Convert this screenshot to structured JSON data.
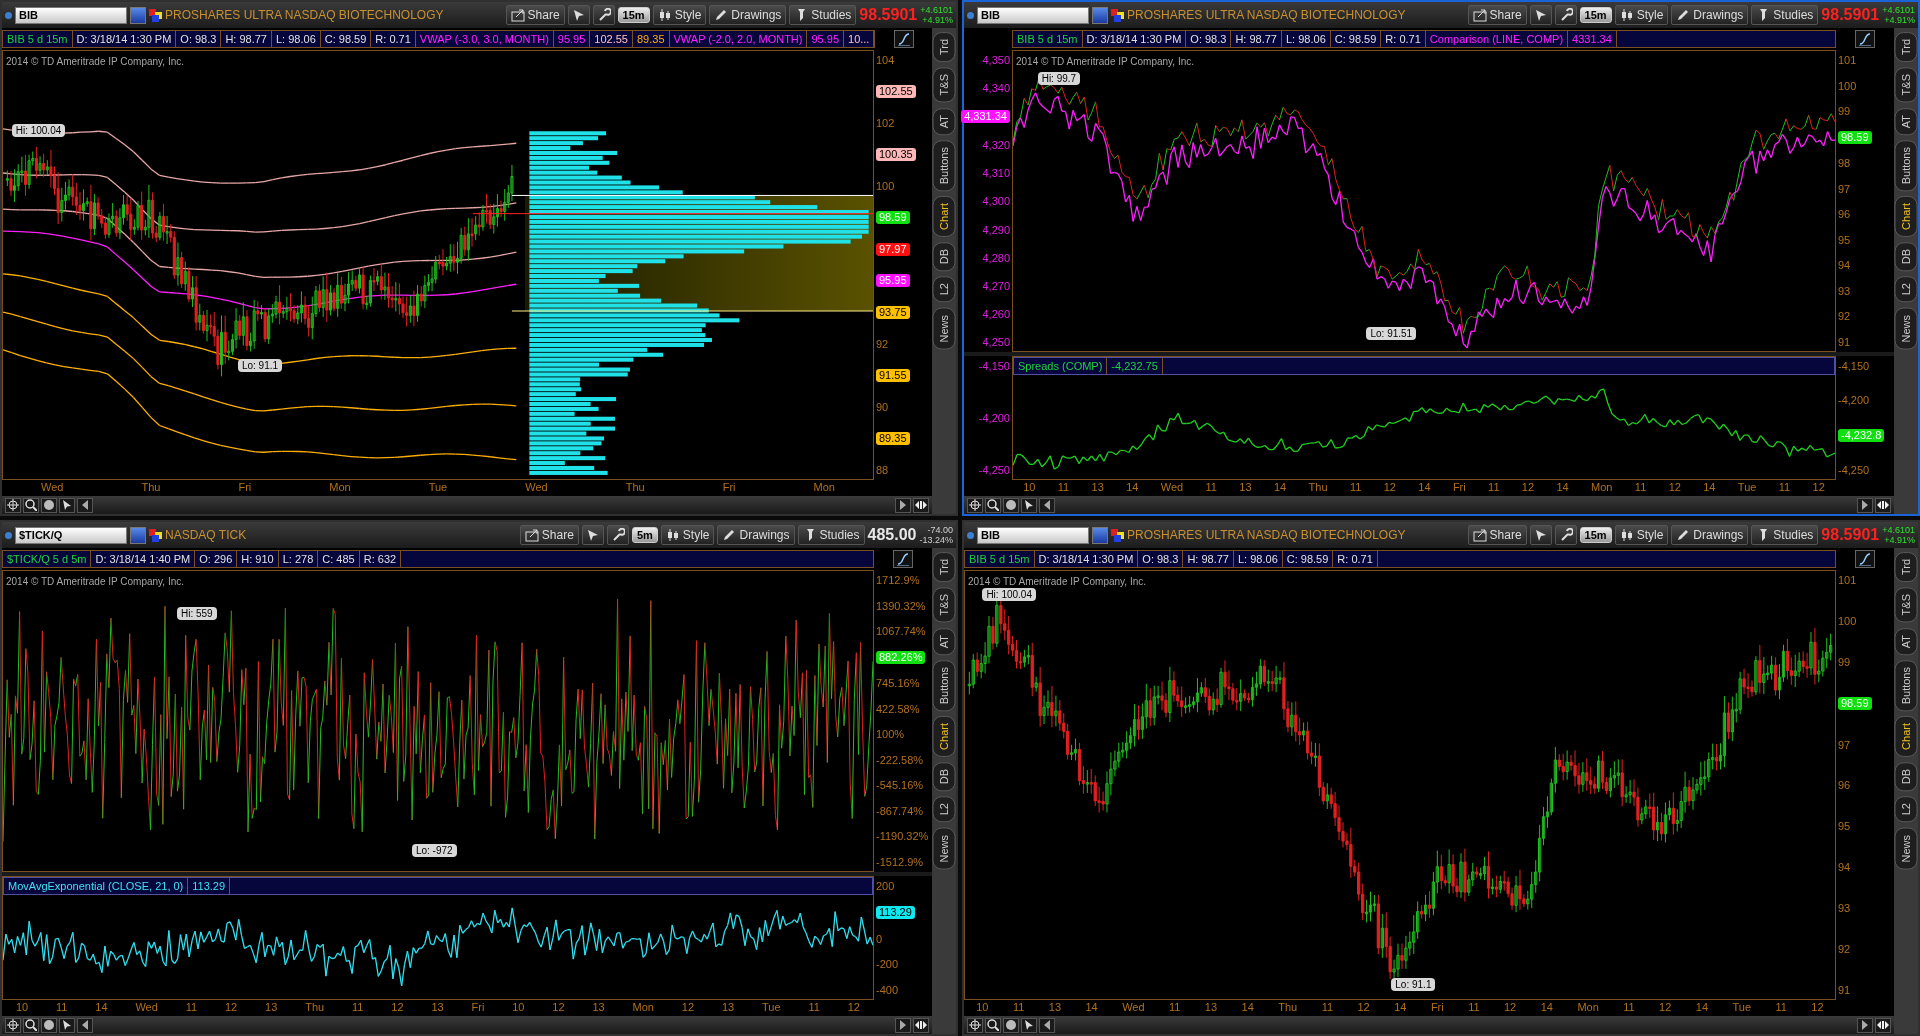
{
  "panes": [
    {
      "active": false,
      "symbol": "BIB",
      "description": "PROSHARES ULTRA NASDAQ BIOTECHNOLOGY",
      "timeframe": "15m",
      "buttons": [
        "Share",
        "Style",
        "Drawings",
        "Studies"
      ],
      "quote": {
        "last": "98.5901",
        "down_tick": true,
        "change": "+4.6101",
        "change_pct": "+4.91%",
        "change_up": true
      },
      "info": [
        {
          "text": "BIB 5 d 15m",
          "kind": "label"
        },
        {
          "text": "D: 3/18/14 1:30 PM",
          "kind": "field"
        },
        {
          "text": "O: 98.3",
          "kind": "field"
        },
        {
          "text": "H: 98.77",
          "kind": "field"
        },
        {
          "text": "L: 98.06",
          "kind": "field"
        },
        {
          "text": "C: 98.59",
          "kind": "field"
        },
        {
          "text": "R: 0.71",
          "kind": "field"
        },
        {
          "text": "VWAP (-3.0, 3.0, MONTH)",
          "kind": "study"
        },
        {
          "text": "95.95",
          "kind": "study"
        },
        {
          "text": "102.55",
          "kind": "upper"
        },
        {
          "text": "89.35",
          "kind": "lower"
        },
        {
          "text": "VWAP (-2.0, 2.0, MONTH)",
          "kind": "study"
        },
        {
          "text": "95.95",
          "kind": "study"
        },
        {
          "text": "10...",
          "kind": "upper"
        }
      ],
      "plot": {
        "kind": "vwap",
        "copyright": "2014 © TD Ameritrade IP Company, Inc.",
        "callouts": [
          {
            "text": "Hi: 100.04"
          },
          {
            "text": "Lo: 91.1"
          }
        ],
        "axis": [
          {
            "text": "104",
            "kind": "tick"
          },
          {
            "text": "102.55",
            "kind": "badge",
            "color": "#ffb8b8"
          },
          {
            "text": "102",
            "kind": "tick"
          },
          {
            "text": "100.35",
            "kind": "badge",
            "color": "#ffb8b8"
          },
          {
            "text": "100",
            "kind": "tick"
          },
          {
            "text": "98.59",
            "kind": "badge",
            "color": "#10e010"
          },
          {
            "text": "97.97",
            "kind": "badge",
            "color": "#ff1010"
          },
          {
            "text": "95.95",
            "kind": "badge",
            "color": "#ff10ff"
          },
          {
            "text": "93.75",
            "kind": "badge",
            "color": "#ffc000"
          },
          {
            "text": "92",
            "kind": "tick"
          },
          {
            "text": "91.55",
            "kind": "badge",
            "color": "#ffc000"
          },
          {
            "text": "90",
            "kind": "tick"
          },
          {
            "text": "89.35",
            "kind": "badge",
            "color": "#ffc000"
          },
          {
            "text": "88",
            "kind": "tick"
          }
        ]
      },
      "x_axis": [
        "Wed",
        "Thu",
        "Fri",
        "Mon",
        "Tue",
        "Wed",
        "Thu",
        "Fri",
        "Mon"
      ],
      "side_tabs": [
        {
          "label": "Trd",
          "selected": false
        },
        {
          "label": "T&S",
          "selected": false
        },
        {
          "label": "AT",
          "selected": false
        },
        {
          "label": "Buttons",
          "selected": false
        },
        {
          "label": "Chart",
          "selected": true
        },
        {
          "label": "DB",
          "selected": false
        },
        {
          "label": "L2",
          "selected": false
        },
        {
          "label": "News",
          "selected": false
        }
      ]
    },
    {
      "active": true,
      "symbol": "BIB",
      "description": "PROSHARES ULTRA NASDAQ BIOTECHNOLOGY",
      "timeframe": "15m",
      "buttons": [
        "Share",
        "Style",
        "Drawings",
        "Studies"
      ],
      "quote": {
        "last": "98.5901",
        "down_tick": true,
        "change": "+4.6101",
        "change_pct": "+4.91%",
        "change_up": true
      },
      "info": [
        {
          "text": "BIB 5 d 15m",
          "kind": "label"
        },
        {
          "text": "D: 3/18/14 1:30 PM",
          "kind": "field"
        },
        {
          "text": "O: 98.3",
          "kind": "field"
        },
        {
          "text": "H: 98.77",
          "kind": "field"
        },
        {
          "text": "L: 98.06",
          "kind": "field"
        },
        {
          "text": "C: 98.59",
          "kind": "field"
        },
        {
          "text": "R: 0.71",
          "kind": "field"
        },
        {
          "text": "Comparison (LINE, COMP)",
          "kind": "study"
        },
        {
          "text": "4331.34",
          "kind": "study"
        }
      ],
      "plot": {
        "kind": "comparison",
        "copyright": "2014 © TD Ameritrade IP Company, Inc.",
        "callouts": [
          {
            "text": "Hi: 99.7"
          },
          {
            "text": "Lo: 91.51"
          }
        ],
        "axis": [
          {
            "text": "101",
            "kind": "tick"
          },
          {
            "text": "100",
            "kind": "tick"
          },
          {
            "text": "99",
            "kind": "tick"
          },
          {
            "text": "98.59",
            "kind": "badge",
            "color": "#10e010"
          },
          {
            "text": "98",
            "kind": "tick"
          },
          {
            "text": "97",
            "kind": "tick"
          },
          {
            "text": "96",
            "kind": "tick"
          },
          {
            "text": "95",
            "kind": "tick"
          },
          {
            "text": "94",
            "kind": "tick"
          },
          {
            "text": "93",
            "kind": "tick"
          },
          {
            "text": "92",
            "kind": "tick"
          },
          {
            "text": "91",
            "kind": "tick"
          }
        ],
        "left_axis": [
          {
            "text": "4,350",
            "kind": "tick"
          },
          {
            "text": "4,340",
            "kind": "tick"
          },
          {
            "text": "4,331.34",
            "kind": "badge",
            "color": "#ff10ff"
          },
          {
            "text": "4,320",
            "kind": "tick"
          },
          {
            "text": "4,310",
            "kind": "tick"
          },
          {
            "text": "4,300",
            "kind": "tick"
          },
          {
            "text": "4,290",
            "kind": "tick"
          },
          {
            "text": "4,280",
            "kind": "tick"
          },
          {
            "text": "4,270",
            "kind": "tick"
          },
          {
            "text": "4,260",
            "kind": "tick"
          },
          {
            "text": "4,250",
            "kind": "tick"
          }
        ]
      },
      "study": {
        "kind": "spread",
        "title": "Spreads (COMP)",
        "value": "-4,232.75",
        "axis": [
          {
            "text": "-4,150",
            "kind": "tick"
          },
          {
            "text": "-4,200",
            "kind": "tick"
          },
          {
            "text": "-4,232.8",
            "kind": "badge",
            "color": "#10e010"
          },
          {
            "text": "-4,250",
            "kind": "tick"
          }
        ],
        "left_axis": [
          {
            "text": "-4,150",
            "kind": "tick"
          },
          {
            "text": "-4,200",
            "kind": "tick"
          },
          {
            "text": "-4,250",
            "kind": "tick"
          }
        ]
      },
      "x_axis": [
        "10",
        "11",
        "13",
        "14",
        "Wed",
        "11",
        "13",
        "14",
        "Thu",
        "11",
        "12",
        "14",
        "Fri",
        "11",
        "12",
        "14",
        "Mon",
        "11",
        "12",
        "14",
        "Tue",
        "11",
        "12"
      ],
      "side_tabs": [
        {
          "label": "Trd",
          "selected": false
        },
        {
          "label": "T&S",
          "selected": false
        },
        {
          "label": "AT",
          "selected": false
        },
        {
          "label": "Buttons",
          "selected": false
        },
        {
          "label": "Chart",
          "selected": true
        },
        {
          "label": "DB",
          "selected": false
        },
        {
          "label": "L2",
          "selected": false
        },
        {
          "label": "News",
          "selected": false
        }
      ]
    },
    {
      "active": false,
      "symbol": "$TICK/Q",
      "description": "NASDAQ TICK",
      "timeframe": "5m",
      "buttons": [
        "Share",
        "Style",
        "Drawings",
        "Studies"
      ],
      "quote": {
        "last": "485.00",
        "down_tick": false,
        "change": "-74.00",
        "change_pct": "-13.24%",
        "change_up": false
      },
      "info": [
        {
          "text": "$TICK/Q 5 d 5m",
          "kind": "label"
        },
        {
          "text": "D: 3/18/14 1:40 PM",
          "kind": "field"
        },
        {
          "text": "O: 296",
          "kind": "field"
        },
        {
          "text": "H: 910",
          "kind": "field"
        },
        {
          "text": "L: 278",
          "kind": "field"
        },
        {
          "text": "C: 485",
          "kind": "field"
        },
        {
          "text": "R: 632",
          "kind": "field"
        }
      ],
      "plot": {
        "kind": "tick",
        "copyright": "2014 © TD Ameritrade IP Company, Inc.",
        "callouts": [
          {
            "text": "Hi: 559"
          },
          {
            "text": "Lo: -972"
          }
        ],
        "axis": [
          {
            "text": "1712.9%",
            "kind": "tick"
          },
          {
            "text": "1390.32%",
            "kind": "tick"
          },
          {
            "text": "1067.74%",
            "kind": "tick"
          },
          {
            "text": "882.26%",
            "kind": "badge",
            "color": "#10e010"
          },
          {
            "text": "745.16%",
            "kind": "tick"
          },
          {
            "text": "422.58%",
            "kind": "tick"
          },
          {
            "text": "100%",
            "kind": "tick"
          },
          {
            "text": "-222.58%",
            "kind": "tick"
          },
          {
            "text": "-545.16%",
            "kind": "tick"
          },
          {
            "text": "-867.74%",
            "kind": "tick"
          },
          {
            "text": "-1190.32%",
            "kind": "tick"
          },
          {
            "text": "-1512.9%",
            "kind": "tick"
          }
        ]
      },
      "study": {
        "kind": "ema",
        "title": "MovAvgExponential (CLOSE, 21, 0)",
        "value": "113.29",
        "axis": [
          {
            "text": "200",
            "kind": "tick"
          },
          {
            "text": "113.29",
            "kind": "badge",
            "color": "#10e8f0"
          },
          {
            "text": "0",
            "kind": "tick"
          },
          {
            "text": "-200",
            "kind": "tick"
          },
          {
            "text": "-400",
            "kind": "tick"
          }
        ]
      },
      "x_axis": [
        "10",
        "11",
        "14",
        "Wed",
        "11",
        "12",
        "13",
        "Thu",
        "11",
        "12",
        "13",
        "Fri",
        "10",
        "12",
        "13",
        "Mon",
        "12",
        "13",
        "Tue",
        "11",
        "12"
      ],
      "side_tabs": [
        {
          "label": "Trd",
          "selected": false
        },
        {
          "label": "T&S",
          "selected": false
        },
        {
          "label": "AT",
          "selected": false
        },
        {
          "label": "Buttons",
          "selected": false
        },
        {
          "label": "Chart",
          "selected": true
        },
        {
          "label": "DB",
          "selected": false
        },
        {
          "label": "L2",
          "selected": false
        },
        {
          "label": "News",
          "selected": false
        }
      ]
    },
    {
      "active": false,
      "symbol": "BIB",
      "description": "PROSHARES ULTRA NASDAQ BIOTECHNOLOGY",
      "timeframe": "15m",
      "buttons": [
        "Share",
        "Style",
        "Drawings",
        "Studies"
      ],
      "quote": {
        "last": "98.5901",
        "down_tick": true,
        "change": "+4.6101",
        "change_pct": "+4.91%",
        "change_up": true
      },
      "info": [
        {
          "text": "BIB 5 d 15m",
          "kind": "label"
        },
        {
          "text": "D: 3/18/14 1:30 PM",
          "kind": "field"
        },
        {
          "text": "O: 98.3",
          "kind": "field"
        },
        {
          "text": "H: 98.77",
          "kind": "field"
        },
        {
          "text": "L: 98.06",
          "kind": "field"
        },
        {
          "text": "C: 98.59",
          "kind": "field"
        },
        {
          "text": "R: 0.71",
          "kind": "field"
        }
      ],
      "plot": {
        "kind": "candles",
        "copyright": "2014 © TD Ameritrade IP Company, Inc.",
        "callouts": [
          {
            "text": "Hi: 100.04"
          },
          {
            "text": "Lo: 91.1"
          }
        ],
        "axis": [
          {
            "text": "101",
            "kind": "tick"
          },
          {
            "text": "100",
            "kind": "tick"
          },
          {
            "text": "99",
            "kind": "tick"
          },
          {
            "text": "98.59",
            "kind": "badge",
            "color": "#10e010"
          },
          {
            "text": "97",
            "kind": "tick"
          },
          {
            "text": "96",
            "kind": "tick"
          },
          {
            "text": "95",
            "kind": "tick"
          },
          {
            "text": "94",
            "kind": "tick"
          },
          {
            "text": "93",
            "kind": "tick"
          },
          {
            "text": "92",
            "kind": "tick"
          },
          {
            "text": "91",
            "kind": "tick"
          }
        ]
      },
      "x_axis": [
        "10",
        "11",
        "13",
        "14",
        "Wed",
        "11",
        "13",
        "14",
        "Thu",
        "11",
        "12",
        "14",
        "Fri",
        "11",
        "12",
        "14",
        "Mon",
        "11",
        "12",
        "14",
        "Tue",
        "11",
        "12"
      ],
      "side_tabs": [
        {
          "label": "Trd",
          "selected": false
        },
        {
          "label": "T&S",
          "selected": false
        },
        {
          "label": "AT",
          "selected": false
        },
        {
          "label": "Buttons",
          "selected": false
        },
        {
          "label": "Chart",
          "selected": true
        },
        {
          "label": "DB",
          "selected": false
        },
        {
          "label": "L2",
          "selected": false
        },
        {
          "label": "News",
          "selected": false
        }
      ]
    }
  ]
}
